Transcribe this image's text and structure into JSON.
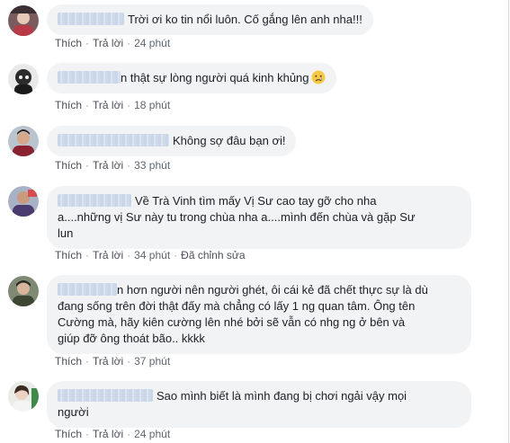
{
  "comments": [
    {
      "text": "Trời ơi ko tin nổi luôn. Cố gắng lên anh nha!!!",
      "like": "Thích",
      "reply": "Trả lời",
      "time": "24 phút"
    },
    {
      "text": "n thật sự lòng người quá kinh khủng",
      "emoji": "crying-face",
      "like": "Thích",
      "reply": "Trả lời",
      "time": "18 phút"
    },
    {
      "text": "Không sợ đâu bạn ơi!",
      "like": "Thích",
      "reply": "Trả lời",
      "time": "33 phút"
    },
    {
      "line1": "Về Trà Vinh tìm mấy Vị Sư cao tay gỡ cho nha",
      "line2": "a....những vị Sư này tu trong chùa nha a....mình đến chùa và gặp Sư",
      "line3": "lun",
      "like": "Thích",
      "reply": "Trả lời",
      "time": "34 phút",
      "edited": "Đã chỉnh sửa"
    },
    {
      "line1": "n hơn người nên người ghét, ôi cái kẻ đã chết thực sự là dù",
      "line2": "đang sống trên đời thật đấy mà chẳng có lấy 1 ng quan tâm. Ông tên",
      "line3": "Cường mà, hãy kiên cường lên nhé bởi sẽ vẫn có nhg ng ở bên và",
      "line4": "giúp đỡ ông thoát bão.. kkkk",
      "like": "Thích",
      "reply": "Trả lời",
      "time": "37 phút"
    },
    {
      "line1": "Sao mình biết là mình đang bị chơi ngải vậy mọi",
      "line2": "người",
      "like": "Thích",
      "reply": "Trả lời",
      "time": "24 phút"
    }
  ],
  "colors": {
    "bubble": "#f2f3f5",
    "action_text": "#4b4f56",
    "meta_text": "#606770",
    "name_redaction": "#d3deee"
  }
}
